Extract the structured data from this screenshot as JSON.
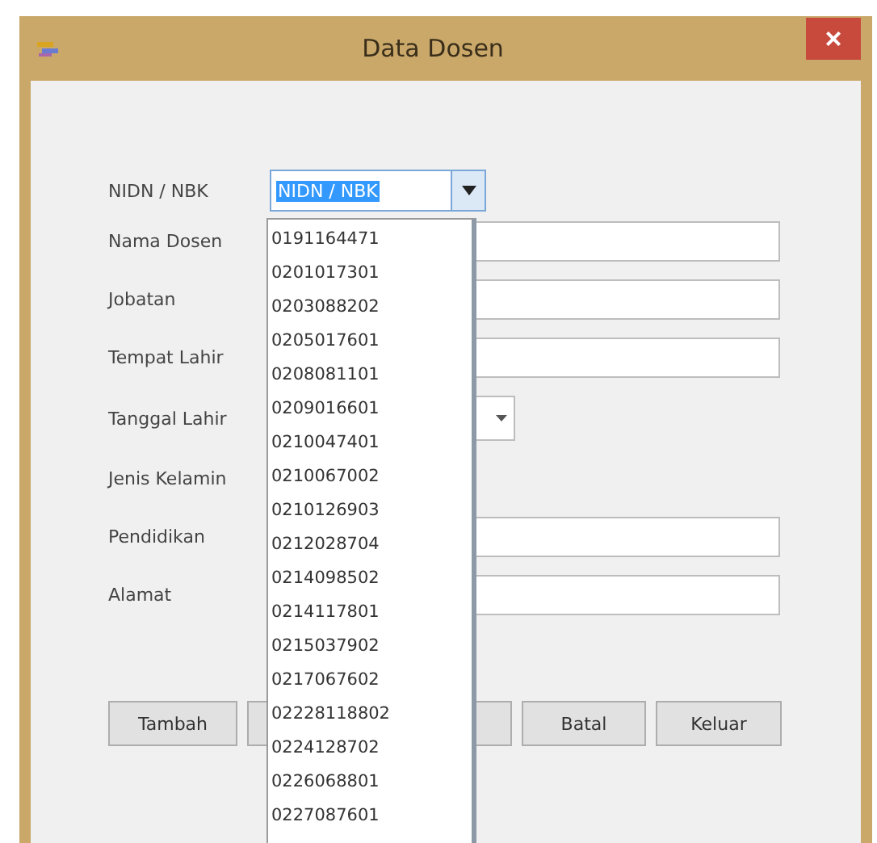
{
  "window": {
    "title": "Data Dosen",
    "close": "×"
  },
  "form": {
    "fields": [
      {
        "kind": "combo",
        "label": "NIDN / NBK",
        "value": "NIDN / NBK",
        "expanded": true
      },
      {
        "kind": "text",
        "label": "Nama Dosen"
      },
      {
        "kind": "text",
        "label": "Jobatan"
      },
      {
        "kind": "text",
        "label": "Tempat Lahir"
      },
      {
        "kind": "date",
        "label": "Tanggal Lahir"
      },
      {
        "kind": "none",
        "label": "Jenis Kelamin"
      },
      {
        "kind": "text",
        "label": "Pendidikan"
      },
      {
        "kind": "text",
        "label": "Alamat"
      }
    ]
  },
  "dropdown": {
    "items": [
      "0191164471",
      "0201017301",
      "0203088202",
      "0205017601",
      "0208081101",
      "0209016601",
      "0210047401",
      "0210067002",
      "0210126903",
      "0212028704",
      "0214098502",
      "0214117801",
      "0215037902",
      "0217067602",
      "02228118802",
      "0224128702",
      "0226068801",
      "0227087601"
    ]
  },
  "buttons": [
    {
      "kind": "button",
      "label": "Tambah"
    },
    {
      "kind": "covered"
    },
    {
      "kind": "covered"
    },
    {
      "kind": "button",
      "label": "Batal"
    },
    {
      "kind": "button",
      "label": "Keluar"
    }
  ]
}
